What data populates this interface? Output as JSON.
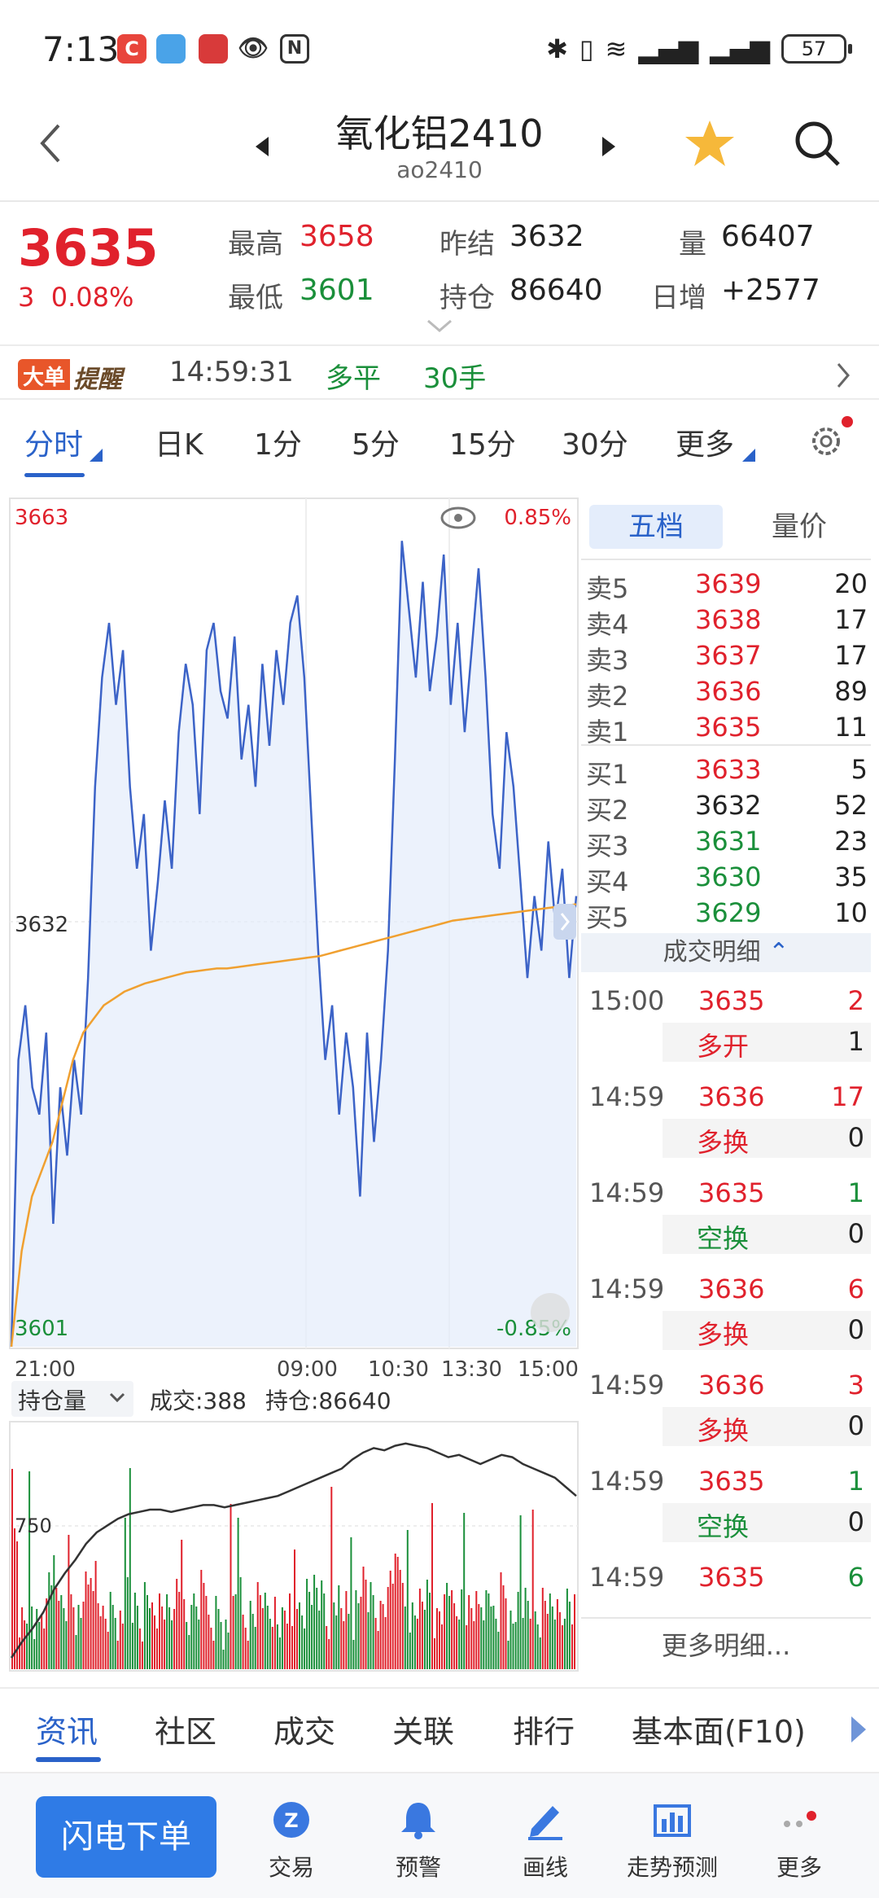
{
  "status_bar": {
    "time": "7:13",
    "battery": "57",
    "apps": [
      "C",
      "",
      "",
      "",
      "N"
    ]
  },
  "nav": {
    "title": "氧化铝2410",
    "code": "ao2410",
    "icons": [
      "back-icon",
      "prev-arrow-icon",
      "next-arrow-icon",
      "star-icon",
      "search-icon"
    ]
  },
  "quote": {
    "price": "3635",
    "change": "3",
    "change_pct": "0.08%",
    "high_label": "最高",
    "high": "3658",
    "low_label": "最低",
    "low": "3601",
    "prev_settle_label": "昨结",
    "prev_settle": "3632",
    "open_interest_label": "持仓",
    "open_interest": "86640",
    "volume_label": "量",
    "volume": "66407",
    "daily_inc_label": "日增",
    "daily_inc": "+2577"
  },
  "alert": {
    "badge_a": "大单",
    "badge_b": "提醒",
    "time": "14:59:31",
    "direction": "多平",
    "qty": "30手"
  },
  "period_tabs": [
    "分时",
    "日K",
    "1分",
    "5分",
    "15分",
    "30分",
    "更多"
  ],
  "chart": {
    "y_top": "3663",
    "y_mid": "3632",
    "y_bottom": "3601",
    "pct_top": "0.85%",
    "pct_bottom": "-0.85%",
    "x_labels": [
      "21:00",
      "09:00",
      "10:30",
      "13:30",
      "15:00"
    ],
    "sub_selector": "持仓量",
    "sub_volume": "成交:388",
    "sub_oi": "持仓:86640",
    "sub_y": "750"
  },
  "chart_data": {
    "type": "line",
    "title": "",
    "ylim": [
      3601,
      3663
    ],
    "price": [
      3601,
      3622,
      3626,
      3620,
      3618,
      3624,
      3610,
      3620,
      3615,
      3622,
      3618,
      3628,
      3642,
      3650,
      3654,
      3648,
      3652,
      3642,
      3636,
      3640,
      3630,
      3635,
      3641,
      3636,
      3646,
      3651,
      3648,
      3640,
      3652,
      3654,
      3649,
      3647,
      3653,
      3644,
      3648,
      3642,
      3651,
      3645,
      3652,
      3648,
      3654,
      3656,
      3650,
      3640,
      3630,
      3622,
      3626,
      3618,
      3624,
      3620,
      3612,
      3624,
      3616,
      3622,
      3630,
      3644,
      3660,
      3655,
      3650,
      3657,
      3649,
      3653,
      3659,
      3648,
      3654,
      3646,
      3652,
      3658,
      3650,
      3640,
      3636,
      3646,
      3642,
      3635,
      3628,
      3634,
      3630,
      3638,
      3632,
      3636,
      3628,
      3634
    ],
    "avg": [
      3601,
      3608,
      3612,
      3614,
      3616,
      3619,
      3622,
      3624,
      3625,
      3626,
      3626.5,
      3627,
      3627.3,
      3627.6,
      3627.8,
      3628,
      3628.2,
      3628.4,
      3628.5,
      3628.6,
      3628.7,
      3628.7,
      3628.8,
      3628.9,
      3629,
      3629.1,
      3629.2,
      3629.3,
      3629.4,
      3629.5,
      3629.6,
      3629.8,
      3630,
      3630.2,
      3630.4,
      3630.6,
      3630.8,
      3631,
      3631.2,
      3631.4,
      3631.6,
      3631.8,
      3632,
      3632.2,
      3632.3,
      3632.4,
      3632.5,
      3632.6,
      3632.7,
      3632.8,
      3632.9,
      3633,
      3633.1,
      3633.2,
      3633.3,
      3633.4
    ],
    "x_labels": [
      "21:00",
      "09:00",
      "10:30",
      "13:30",
      "15:00"
    ],
    "open_interest_line": [
      0.05,
      0.12,
      0.18,
      0.25,
      0.35,
      0.42,
      0.48,
      0.55,
      0.6,
      0.63,
      0.66,
      0.68,
      0.69,
      0.7,
      0.7,
      0.69,
      0.7,
      0.71,
      0.72,
      0.72,
      0.71,
      0.72,
      0.73,
      0.74,
      0.75,
      0.76,
      0.78,
      0.8,
      0.82,
      0.84,
      0.86,
      0.88,
      0.92,
      0.95,
      0.97,
      0.96,
      0.98,
      0.99,
      0.98,
      0.97,
      0.95,
      0.93,
      0.94,
      0.92,
      0.9,
      0.92,
      0.94,
      0.93,
      0.9,
      0.88,
      0.86,
      0.84,
      0.8,
      0.76
    ]
  },
  "depth": {
    "tab_active": "五档",
    "tab_inactive": "量价",
    "asks": [
      {
        "label": "卖5",
        "price": "3639",
        "vol": "20"
      },
      {
        "label": "卖4",
        "price": "3638",
        "vol": "17"
      },
      {
        "label": "卖3",
        "price": "3637",
        "vol": "17"
      },
      {
        "label": "卖2",
        "price": "3636",
        "vol": "89"
      },
      {
        "label": "卖1",
        "price": "3635",
        "vol": "11"
      }
    ],
    "bids": [
      {
        "label": "买1",
        "price": "3633",
        "vol": "5"
      },
      {
        "label": "买2",
        "price": "3632",
        "vol": "52"
      },
      {
        "label": "买3",
        "price": "3631",
        "vol": "23"
      },
      {
        "label": "买4",
        "price": "3630",
        "vol": "35"
      },
      {
        "label": "买5",
        "price": "3629",
        "vol": "10"
      }
    ],
    "detail_header": "成交明细",
    "trades": [
      {
        "time": "15:00",
        "price": "3635",
        "vol": "2",
        "vol_color": "red",
        "kind": "多开",
        "kind_color": "red",
        "oi": "1"
      },
      {
        "time": "14:59",
        "price": "3636",
        "vol": "17",
        "vol_color": "red",
        "kind": "多换",
        "kind_color": "red",
        "oi": "0"
      },
      {
        "time": "14:59",
        "price": "3635",
        "vol": "1",
        "vol_color": "green",
        "kind": "空换",
        "kind_color": "green",
        "oi": "0"
      },
      {
        "time": "14:59",
        "price": "3636",
        "vol": "6",
        "vol_color": "red",
        "kind": "多换",
        "kind_color": "red",
        "oi": "0"
      },
      {
        "time": "14:59",
        "price": "3636",
        "vol": "3",
        "vol_color": "red",
        "kind": "多换",
        "kind_color": "red",
        "oi": "0"
      },
      {
        "time": "14:59",
        "price": "3635",
        "vol": "1",
        "vol_color": "green",
        "kind": "空换",
        "kind_color": "green",
        "oi": "0"
      },
      {
        "time": "14:59",
        "price": "3635",
        "vol": "6",
        "vol_color": "green"
      }
    ],
    "more": "更多明细..."
  },
  "info_tabs": [
    "资讯",
    "社区",
    "成交",
    "关联",
    "排行",
    "基本面(F10)"
  ],
  "toolbar": {
    "flash": "闪电下单",
    "items": [
      "交易",
      "预警",
      "画线",
      "走势预测",
      "更多"
    ]
  },
  "colors": {
    "up": "#e0212c",
    "down": "#1a8f3a",
    "accent": "#2a62c9",
    "line": "#3c63c7",
    "avg": "#f0a030"
  }
}
